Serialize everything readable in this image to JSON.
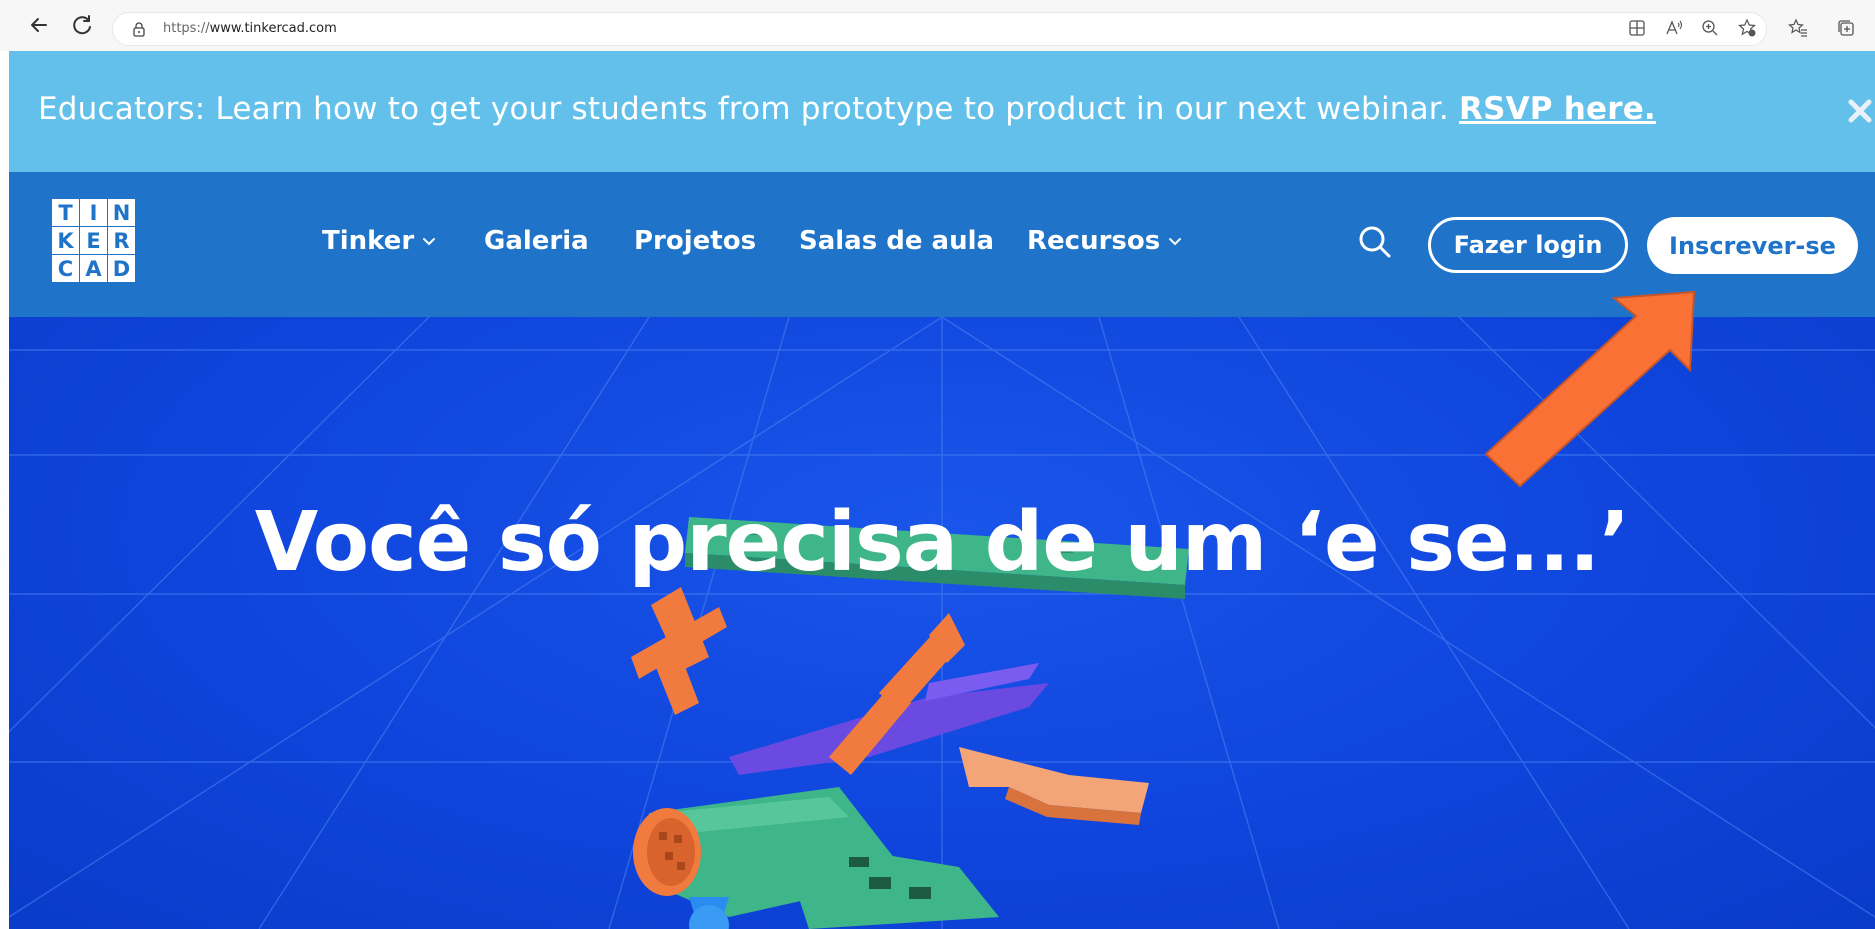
{
  "browser": {
    "url_scheme": "https://",
    "url_host": "www.tinkercad.com",
    "icons": [
      "back-icon",
      "reload-icon",
      "lock-icon",
      "app-icon",
      "read-aloud-icon",
      "zoom-icon",
      "favorite-add-icon",
      "favorites-icon",
      "collections-icon"
    ]
  },
  "banner": {
    "text": "Educators: Learn how to get your students from prototype to product in our next webinar. ",
    "link": "RSVP here."
  },
  "header": {
    "logo_letters": [
      "T",
      "I",
      "N",
      "K",
      "E",
      "R",
      "C",
      "A",
      "D"
    ],
    "nav": {
      "tinker": "Tinker",
      "galeria": "Galeria",
      "projetos": "Projetos",
      "salas": "Salas de aula",
      "recursos": "Recursos"
    },
    "login": "Fazer login",
    "signup": "Inscrever-se"
  },
  "hero": {
    "title": "Você só precisa de um ‘e se...’"
  },
  "colors": {
    "banner_bg": "#63c0ea",
    "header_bg": "#1f74c9",
    "hero_bg": "#0f45dc",
    "arrow": "#f97134",
    "model_green": "#3fb58a",
    "model_orange": "#f17a3e",
    "model_purple": "#6a4ae0",
    "model_lime": "#cfe04a"
  }
}
